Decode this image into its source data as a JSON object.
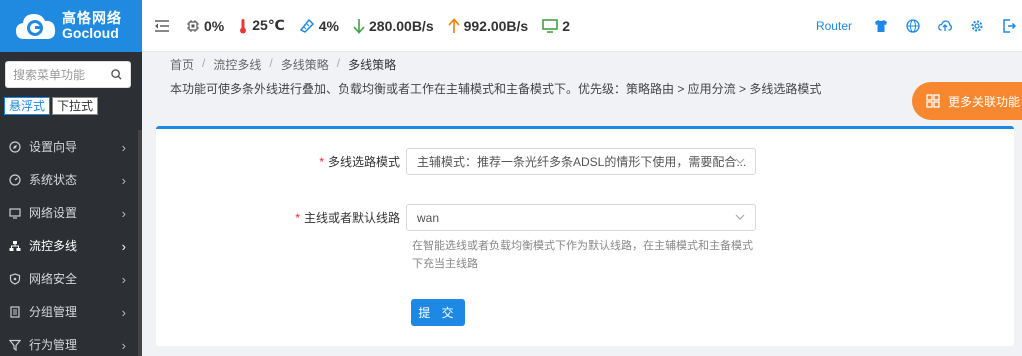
{
  "brand": {
    "name_cn": "高恪网络",
    "name_en": "Gocloud",
    "color": "#1f8ae0"
  },
  "sidebar": {
    "search_placeholder": "搜索菜单功能",
    "modes": [
      "悬浮式",
      "下拉式"
    ],
    "active_mode": "悬浮式",
    "items": [
      {
        "label": "设置向导",
        "icon": "compass-icon"
      },
      {
        "label": "系统状态",
        "icon": "gauge-icon"
      },
      {
        "label": "网络设置",
        "icon": "monitor-icon"
      },
      {
        "label": "流控多线",
        "icon": "network-icon",
        "active": true
      },
      {
        "label": "网络安全",
        "icon": "shield-icon"
      },
      {
        "label": "分组管理",
        "icon": "document-icon"
      },
      {
        "label": "行为管理",
        "icon": "filter-icon"
      }
    ]
  },
  "header": {
    "cpu": "0%",
    "temperature": "25℃",
    "memory": "4%",
    "download": "280.00B/s",
    "upload": "992.00B/s",
    "devices": "2",
    "router_label": "Router"
  },
  "breadcrumb": [
    "首页",
    "流控多线",
    "多线策略",
    "多线策略"
  ],
  "description": "本功能可使多条外线进行叠加、负载均衡或者工作在主辅模式和主备模式下。优先级：策略路由 > 应用分流 > 多线选路模式",
  "float_button": "更多关联功能",
  "form": {
    "mode_label": "多线选路模式",
    "mode_value": "主辅模式：推荐一条光纤多条ADSL的情形下使用，需要配合...",
    "line_label": "主线或者默认线路",
    "line_value": "wan",
    "line_help": "在智能选线或者负载均衡模式下作为默认线路，在主辅模式和主备模式下充当主线路",
    "submit": "提 交"
  },
  "colors": {
    "accent": "#1e88e5",
    "sidebar_bg": "#2c3034",
    "float": "#f7882f"
  }
}
